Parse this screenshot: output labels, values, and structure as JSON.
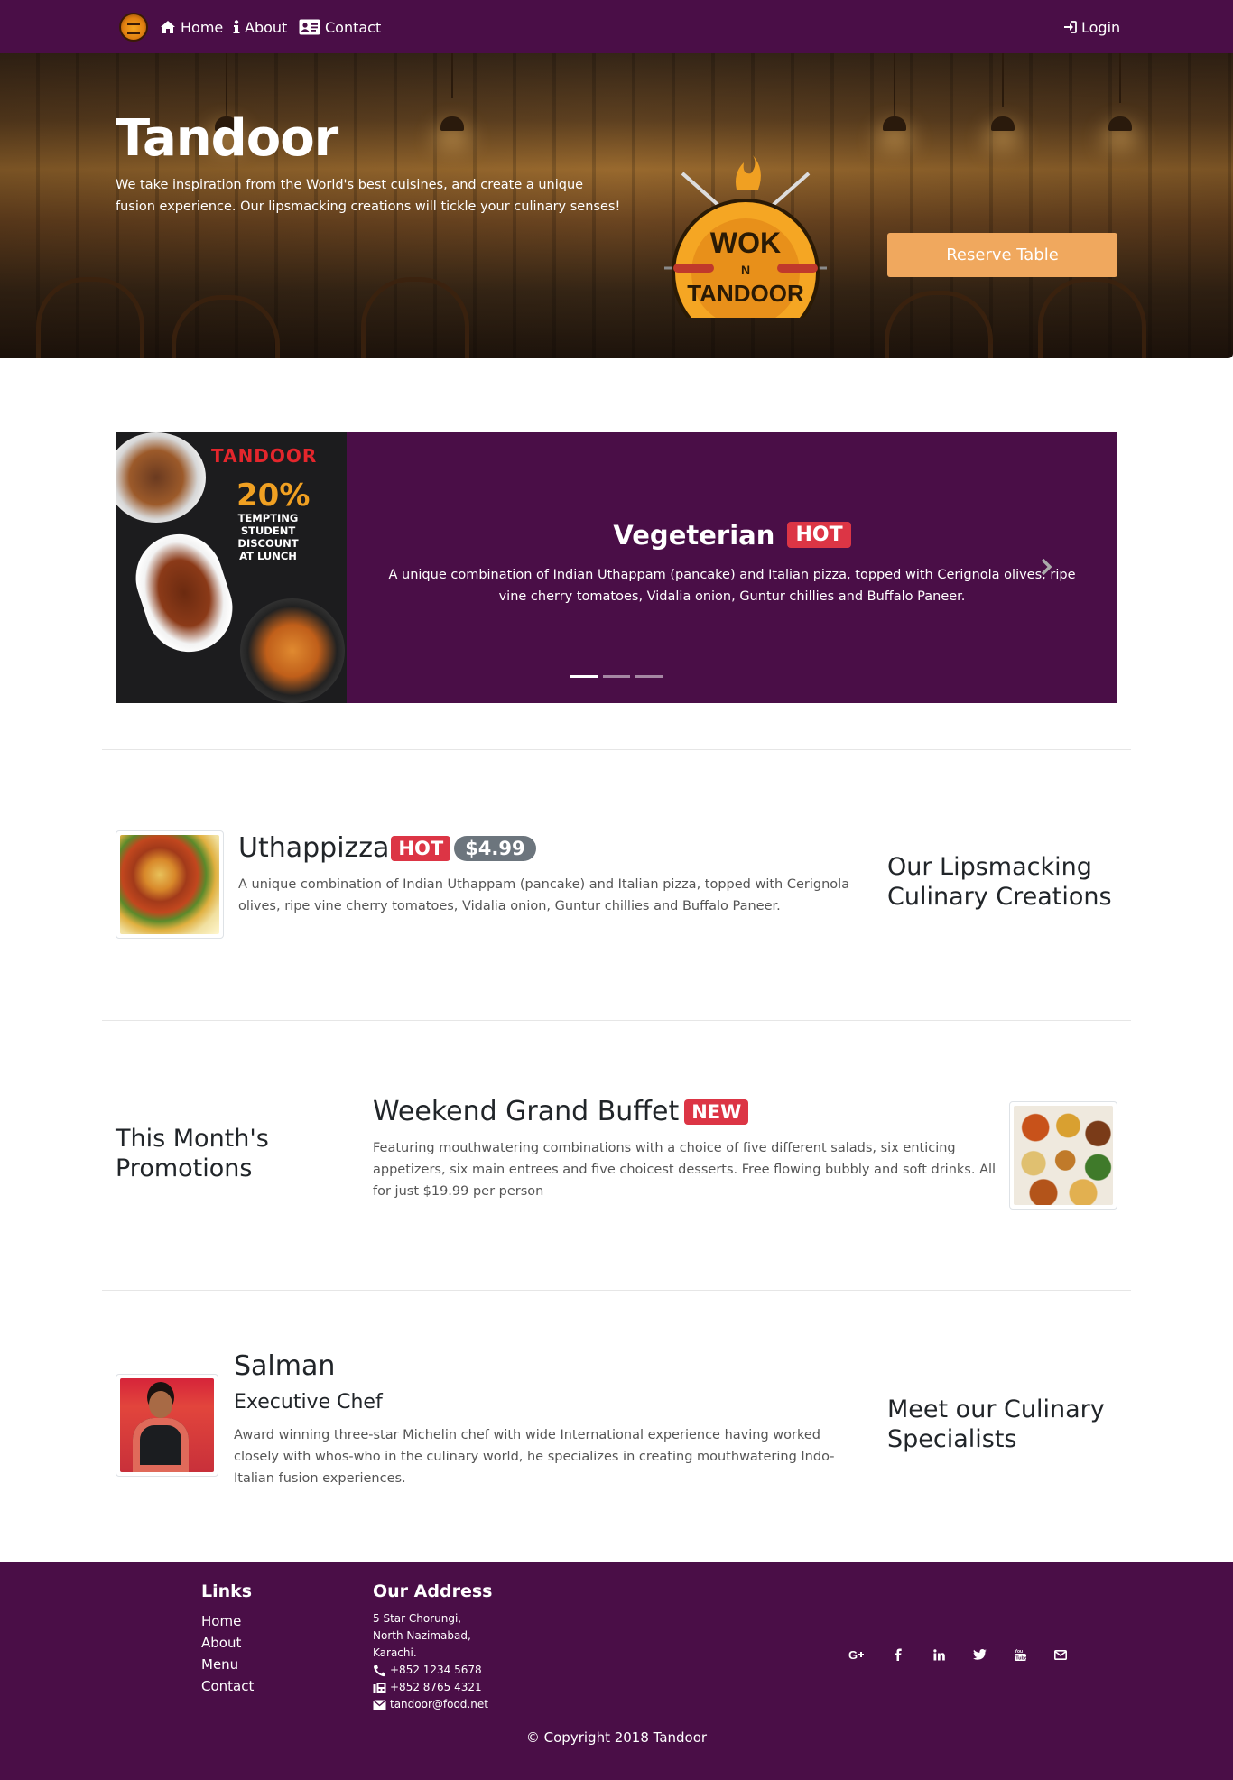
{
  "nav": {
    "home": "Home",
    "about": "About",
    "contact": "Contact",
    "login": "Login"
  },
  "hero": {
    "title": "Tandoor",
    "text": "We take inspiration from the World's best cuisines, and create a unique fusion experience. Our lipsmacking creations will tickle your culinary senses!",
    "reserve_label": "Reserve Table",
    "logo_line1": "WOK",
    "logo_line2": "N",
    "logo_line3": "TANDOOR"
  },
  "carousel": {
    "promo_brand": "TANDOOR",
    "promo_percent": "20%",
    "promo_line1": "TEMPTING",
    "promo_line2": "STUDENT DISCOUNT",
    "promo_line3": "AT LUNCH",
    "title": "Vegeterian",
    "badge": "HOT",
    "text": "A unique combination of Indian Uthappam (pancake) and Italian pizza, topped with Cerignola olives, ripe vine cherry tomatoes, Vidalia onion, Guntur chillies and Buffalo Paneer.",
    "active_slide": 1,
    "slide_count": 3
  },
  "dish": {
    "name": "Uthappizza",
    "badge": "HOT",
    "price": "$4.99",
    "description": "A unique combination of Indian Uthappam (pancake) and Italian pizza, topped with Cerignola olives, ripe vine cherry tomatoes, Vidalia onion, Guntur chillies and Buffalo Paneer.",
    "section_title": "Our Lipsmacking Culinary Creations"
  },
  "promotion": {
    "section_title": "This Month's Promotions",
    "name": "Weekend Grand Buffet",
    "badge": "NEW",
    "description": "Featuring mouthwatering combinations with a choice of five different salads, six enticing appetizers, six main entrees and five choicest desserts. Free flowing bubbly and soft drinks. All for just $19.99 per person"
  },
  "leader": {
    "name": "Salman",
    "role": "Executive Chef",
    "description": "Award winning three-star Michelin chef with wide International experience having worked closely with whos-who in the culinary world, he specializes in creating mouthwatering Indo-Italian fusion experiences.",
    "section_title": "Meet our Culinary Specialists"
  },
  "footer": {
    "links_title": "Links",
    "links": [
      "Home",
      "About",
      "Menu",
      "Contact"
    ],
    "address_title": "Our Address",
    "address_lines": [
      "5 Star Chorungi,",
      "North Nazimabad,",
      "Karachi."
    ],
    "phone": "+852 1234 5678",
    "fax": "+852 8765 4321",
    "email": "tandoor@food.net",
    "social_icons": [
      "google-plus-icon",
      "facebook-icon",
      "linkedin-icon",
      "twitter-icon",
      "youtube-icon",
      "mail-icon"
    ],
    "copyright": "© Copyright 2018 Tandoor"
  },
  "colors": {
    "brand_purple": "#4a0e47",
    "reserve_orange": "#f0a85e",
    "danger": "#dc3545",
    "secondary": "#6c757d"
  }
}
